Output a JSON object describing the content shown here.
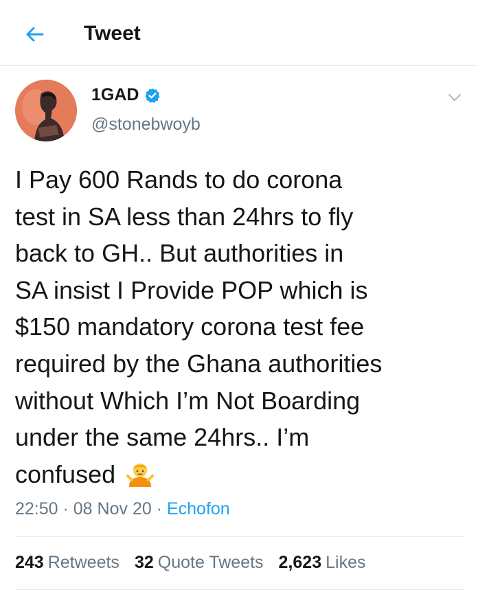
{
  "header": {
    "title": "Tweet"
  },
  "tweet": {
    "display_name": "1GAD",
    "handle": "@stonebwoyb",
    "lines": [
      "I Pay 600 Rands to do corona",
      "test in SA less than 24hrs to fly",
      "back to GH.. But authorities in",
      "SA insist I Provide POP which is",
      "$150 mandatory corona test fee",
      "required by the Ghana authorities",
      "without Which I’m Not Boarding",
      "under the same 24hrs.. I’m",
      "confused"
    ],
    "emoji": "person-shrugging-emoji",
    "time": "22:50",
    "date": "08 Nov 20",
    "source": "Echofon",
    "separator": " · "
  },
  "stats": {
    "retweets_count": "243",
    "retweets_label": "Retweets",
    "quotes_count": "32",
    "quotes_label": "Quote Tweets",
    "likes_count": "2,623",
    "likes_label": "Likes"
  },
  "colors": {
    "accent": "#1da1f2",
    "secondary_text": "#657786",
    "primary_text": "#14171a",
    "divider": "#e6ecf0"
  },
  "icons": [
    "back-arrow-icon",
    "verified-badge-icon",
    "chevron-down-icon"
  ]
}
